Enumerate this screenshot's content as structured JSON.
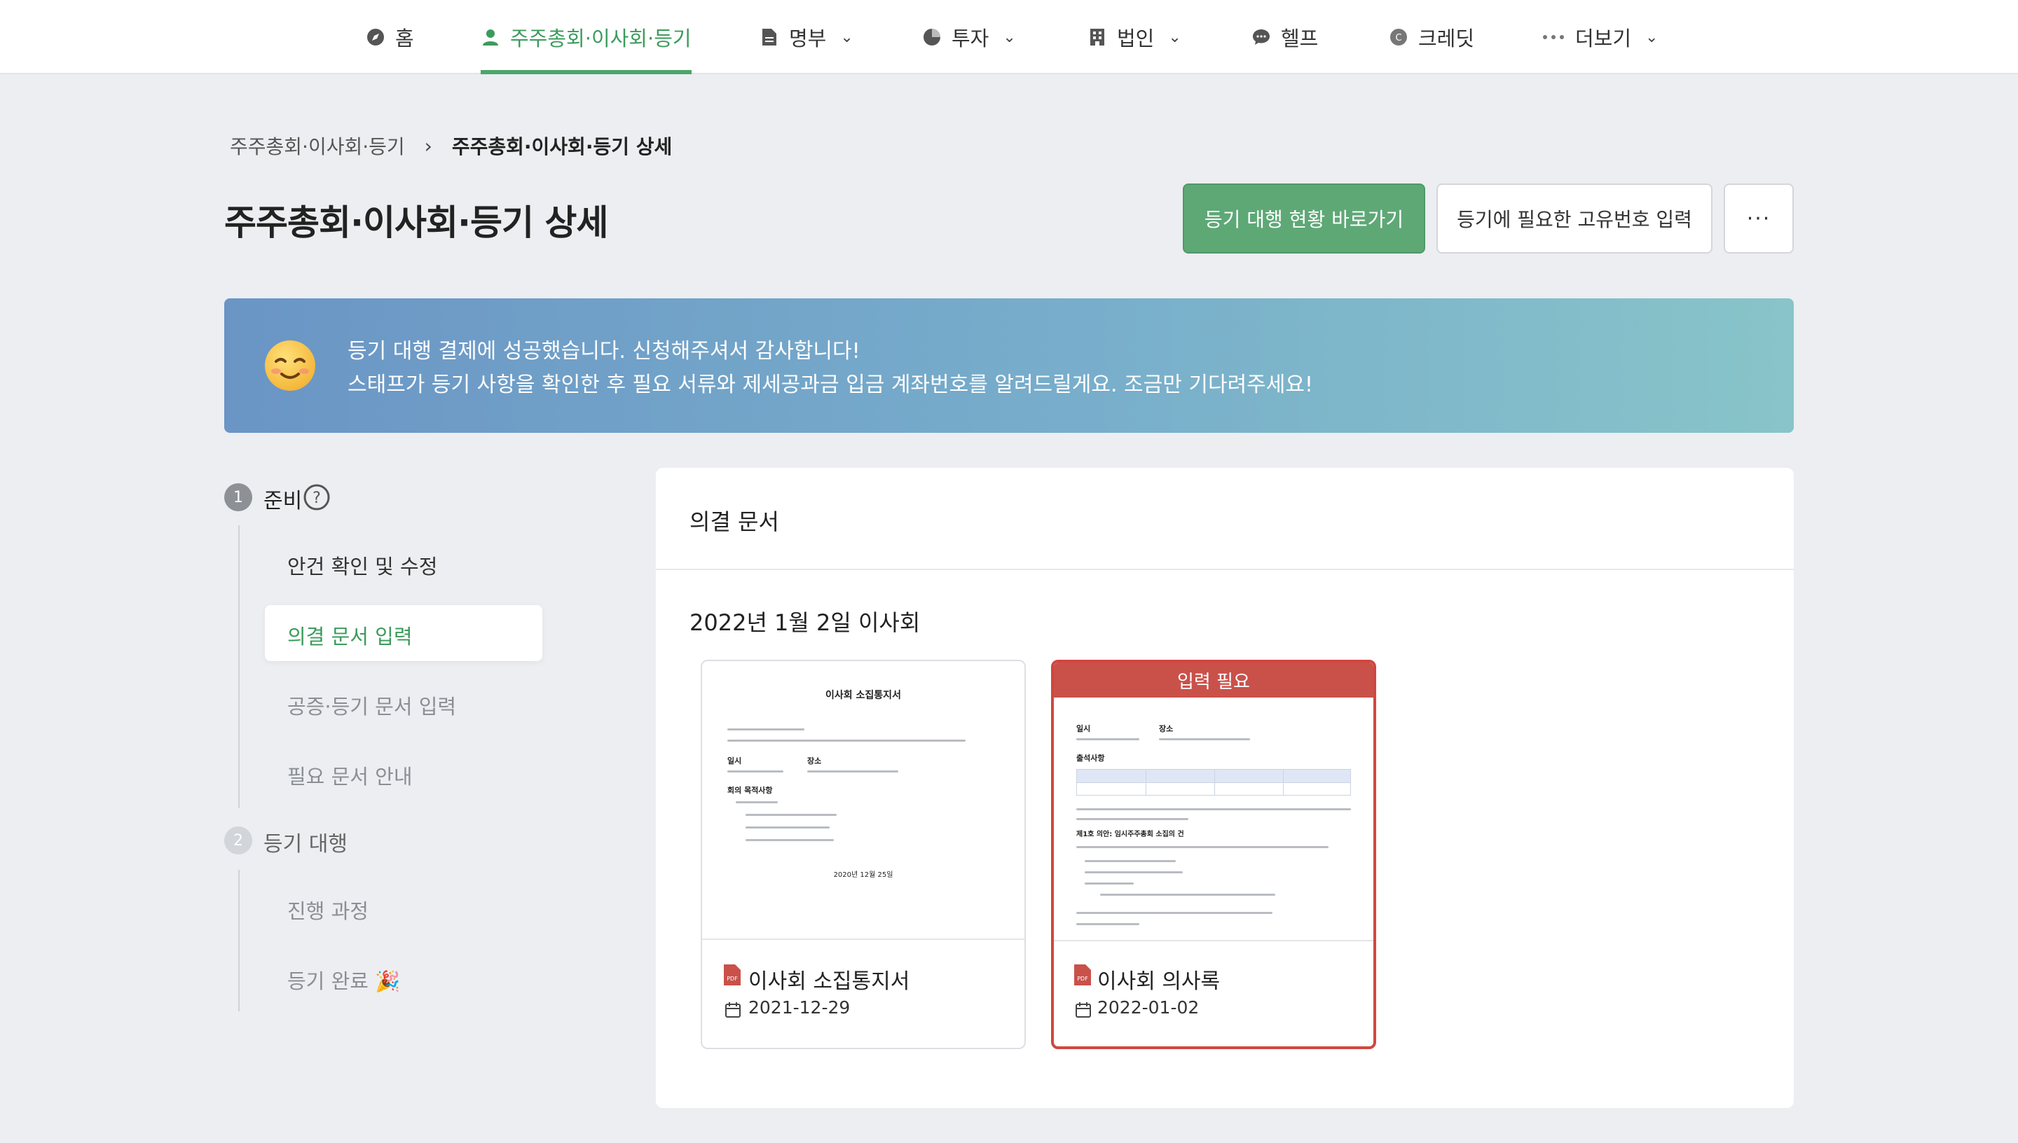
{
  "nav": {
    "items": [
      {
        "label": "홈",
        "icon": "compass-icon"
      },
      {
        "label": "주주총회·이사회·등기",
        "icon": "person-icon",
        "active": true
      },
      {
        "label": "명부",
        "icon": "document-icon",
        "dropdown": true
      },
      {
        "label": "투자",
        "icon": "pie-chart-icon",
        "dropdown": true
      },
      {
        "label": "법인",
        "icon": "building-icon",
        "dropdown": true
      },
      {
        "label": "헬프",
        "icon": "chat-icon"
      },
      {
        "label": "크레딧",
        "icon": "coin-icon"
      },
      {
        "label": "더보기",
        "icon": "dots-icon",
        "dropdown": true
      }
    ]
  },
  "breadcrumb": {
    "parent": "주주총회·이사회·등기",
    "separator": "›",
    "current": "주주총회·이사회·등기 상세"
  },
  "page_title": "주주총회·이사회·등기 상세",
  "actions": {
    "primary": "등기 대행 현황 바로가기",
    "secondary": "등기에 필요한 고유번호 입력",
    "more": "···"
  },
  "banner": {
    "emoji": "smiling-face-emoji",
    "line1": "등기 대행 결제에 성공했습니다. 신청해주셔서 감사합니다!",
    "line2": "스태프가 등기 사항을 확인한 후 필요 서류와 제세공과금 입금 계좌번호를 알려드릴게요. 조금만 기다려주세요!",
    "colors": {
      "start": "#6a95c5",
      "end": "#88c4c9"
    }
  },
  "steps": [
    {
      "number": "1",
      "title": "준비",
      "help_icon": "question-circle-icon",
      "items": [
        {
          "label": "안건 확인 및 수정",
          "state": "done"
        },
        {
          "label": "의결 문서 입력",
          "state": "active"
        },
        {
          "label": "공증·등기 문서 입력",
          "state": "pending"
        },
        {
          "label": "필요 문서 안내",
          "state": "pending"
        }
      ]
    },
    {
      "number": "2",
      "title": "등기 대행",
      "items": [
        {
          "label": "진행 과정",
          "state": "pending"
        },
        {
          "label": "등기 완료 🎉",
          "state": "pending"
        }
      ]
    }
  ],
  "main": {
    "card_title": "의결 문서",
    "meeting_title": "2022년 1월 2일 이사회",
    "documents": [
      {
        "name": "이사회 소집통지서",
        "date": "2021-12-29",
        "preview": {
          "heading": "이사회 소집통지서",
          "col1": "일시",
          "col2": "장소",
          "section": "회의 목적사항",
          "footer_date": "2020년 12월 25일"
        }
      },
      {
        "name": "이사회 의사록",
        "date": "2022-01-02",
        "badge": "입력 필요",
        "preview": {
          "col1": "일시",
          "col2": "장소",
          "section": "출석사항",
          "agenda": "제1호 의안: 임시주주총회 소집의 건"
        }
      }
    ]
  },
  "colors": {
    "accent_green": "#3b9b5c",
    "button_green": "#5ea876",
    "alert_red": "#c9514a",
    "background": "#eceef1"
  }
}
